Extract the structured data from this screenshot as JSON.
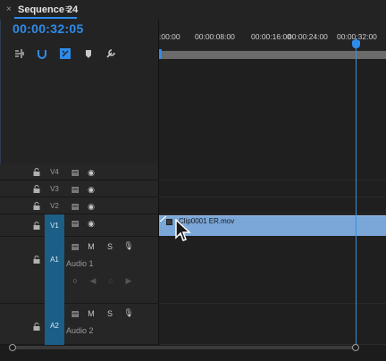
{
  "tab": {
    "close_glyph": "×",
    "title": "Sequence 24",
    "menu_glyph": "≡"
  },
  "timecode": "00:00:32:05",
  "tools": [
    {
      "name": "insert-sequence-nest-icon"
    },
    {
      "name": "snap-icon"
    },
    {
      "name": "linked-selection-icon"
    },
    {
      "name": "add-marker-icon"
    },
    {
      "name": "timeline-settings-wrench-icon"
    }
  ],
  "ruler": {
    "labels": [
      ":00:00",
      "00:00:08:00",
      "00:00:16:00",
      "00:00:24:00",
      "00:00:32:00"
    ]
  },
  "tracks": {
    "video": [
      {
        "name": "V4",
        "active": false
      },
      {
        "name": "V3",
        "active": false
      },
      {
        "name": "V2",
        "active": false
      },
      {
        "name": "V1",
        "active": true
      }
    ],
    "audio": [
      {
        "name": "A1",
        "label": "Audio 1",
        "mute": "M",
        "solo": "S"
      },
      {
        "name": "A2",
        "label": "Audio 2",
        "mute": "M",
        "solo": "S"
      }
    ]
  },
  "clip": {
    "name": "Clip0001 ER.mov"
  },
  "colors": {
    "accent": "#2d8ceb",
    "clip": "#7aa6d8",
    "track_active": "#1b5e86"
  }
}
